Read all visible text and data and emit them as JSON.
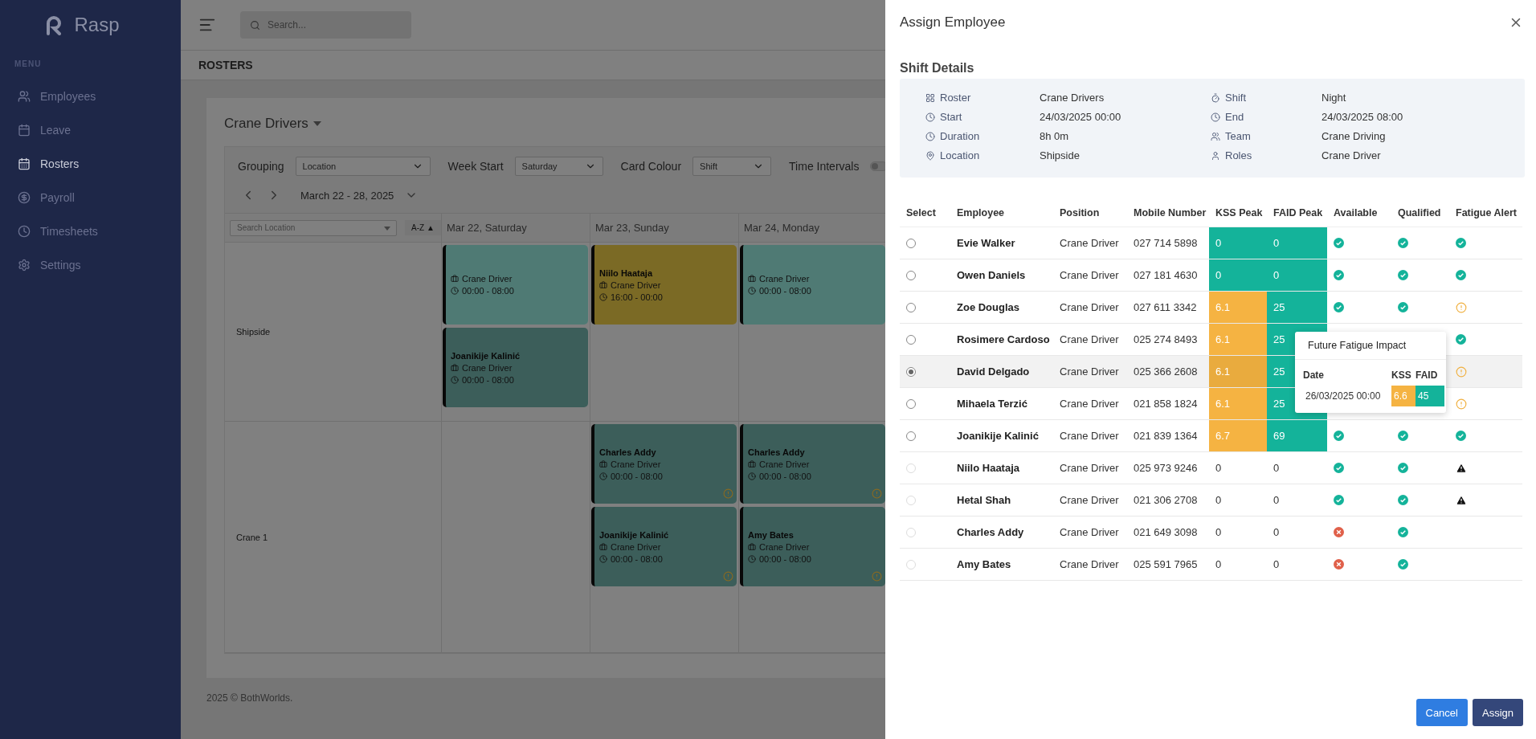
{
  "sidebar": {
    "brand": "Rasp",
    "section": "MENU",
    "items": [
      {
        "label": "Employees",
        "selected": false
      },
      {
        "label": "Leave",
        "selected": false
      },
      {
        "label": "Rosters",
        "selected": true
      },
      {
        "label": "Payroll",
        "selected": false
      },
      {
        "label": "Timesheets",
        "selected": false
      },
      {
        "label": "Settings",
        "selected": false
      }
    ]
  },
  "header": {
    "search": {
      "placeholder": "Search..."
    }
  },
  "page_title": "ROSTERS",
  "roster": {
    "name": "Crane Drivers",
    "filters": [
      {
        "label": "Grouping",
        "value": "Location"
      },
      {
        "label": "Week Start",
        "value": "Saturday"
      },
      {
        "label": "Card Colour",
        "value": "Shift"
      }
    ],
    "time_intervals": {
      "label": "Time Intervals",
      "on": false
    },
    "date_range": "March 22 - 28, 2025",
    "search_location": {
      "placeholder": "Search Location"
    },
    "sort": "A-Z ▲",
    "days": [
      "Mar 22, Saturday",
      "Mar 23, Sunday",
      "Mar 24, Monday"
    ],
    "groups": [
      {
        "name": "Shipside",
        "days": [
          {
            "kind": "shifts",
            "cards": [
              {
                "role": "Crane Driver",
                "time": "00:00 - 08:00",
                "color": "#4f7a74",
                "alert": false
              },
              {
                "employee": "Joanikije Kalinić",
                "role": "Crane Driver",
                "time": "00:00 - 08:00",
                "color": "#3c5e5a",
                "alert": false
              }
            ]
          },
          {
            "kind": "shifts",
            "cards": [
              {
                "employee": "Niilo Haataja",
                "role": "Crane Driver",
                "time": "16:00 - 00:00",
                "color": "#7b6a25",
                "alert": false
              }
            ]
          },
          {
            "kind": "shifts",
            "cards": [
              {
                "role": "Crane Driver",
                "time": "00:00 - 08:00",
                "color": "#4f7a74",
                "alert": false
              }
            ]
          }
        ]
      },
      {
        "name": "Crane 1",
        "days": [
          {
            "kind": "empty"
          },
          {
            "kind": "shifts",
            "cards": [
              {
                "employee": "Charles Addy",
                "role": "Crane Driver",
                "time": "00:00 - 08:00",
                "color": "#3c5e5a",
                "alert": true
              },
              {
                "employee": "Joanikije Kalinić",
                "role": "Crane Driver",
                "time": "00:00 - 08:00",
                "color": "#3c5e5a",
                "alert": true
              }
            ]
          },
          {
            "kind": "shifts",
            "cards": [
              {
                "employee": "Charles Addy",
                "role": "Crane Driver",
                "time": "00:00 - 08:00",
                "color": "#3c5e5a",
                "alert": true
              },
              {
                "employee": "Amy Bates",
                "role": "Crane Driver",
                "time": "00:00 - 08:00",
                "color": "#3c5e5a",
                "alert": true
              }
            ]
          }
        ]
      }
    ]
  },
  "footer": "2025 © BothWorlds.",
  "drawer": {
    "title": "Assign Employee",
    "section": "Shift Details",
    "details": [
      {
        "label": "Roster",
        "value": "Crane Drivers"
      },
      {
        "label": "Shift",
        "value": "Night"
      },
      {
        "label": "Start",
        "value": "24/03/2025 00:00"
      },
      {
        "label": "End",
        "value": "24/03/2025 08:00"
      },
      {
        "label": "Duration",
        "value": "8h 0m"
      },
      {
        "label": "Team",
        "value": "Crane Driving"
      },
      {
        "label": "Location",
        "value": "Shipside"
      },
      {
        "label": "Roles",
        "value": "Crane Driver"
      }
    ],
    "columns": [
      "Select",
      "Employee",
      "Position",
      "Mobile Number",
      "KSS Peak",
      "FAID Peak",
      "Available",
      "Qualified",
      "Fatigue Alert"
    ],
    "rows": [
      {
        "selected": false,
        "disabled": false,
        "employee": "Evie Walker",
        "position": "Crane Driver",
        "mobile": "027 714 5898",
        "kss": {
          "value": "0",
          "color": "#14b39a"
        },
        "faid": {
          "value": "0",
          "color": "#14b39a"
        },
        "available": true,
        "qualified": true,
        "fatigue_alert": {
          "kind": "ok"
        }
      },
      {
        "selected": false,
        "disabled": false,
        "employee": "Owen Daniels",
        "position": "Crane Driver",
        "mobile": "027 181 4630",
        "kss": {
          "value": "0",
          "color": "#14b39a"
        },
        "faid": {
          "value": "0",
          "color": "#14b39a"
        },
        "available": true,
        "qualified": true,
        "fatigue_alert": {
          "kind": "ok"
        }
      },
      {
        "selected": false,
        "disabled": false,
        "employee": "Zoe Douglas",
        "position": "Crane Driver",
        "mobile": "027 611 3342",
        "kss": {
          "value": "6.1",
          "color": "#f5b342"
        },
        "faid": {
          "value": "25",
          "color": "#14b39a"
        },
        "available": true,
        "qualified": true,
        "fatigue_alert": {
          "kind": "warning"
        }
      },
      {
        "selected": false,
        "disabled": false,
        "employee": "Rosimere Cardoso",
        "position": "Crane Driver",
        "mobile": "025 274 8493",
        "kss": {
          "value": "6.1",
          "color": "#f5b342"
        },
        "faid": {
          "value": "25",
          "color": "#14b39a"
        },
        "fatigue_alert": {
          "kind": "ok"
        }
      },
      {
        "selected": true,
        "disabled": false,
        "employee": "David Delgado",
        "position": "Crane Driver",
        "mobile": "025 366 2608",
        "kss": {
          "value": "6.1",
          "color": "#e9ab3e"
        },
        "faid": {
          "value": "25",
          "color": "#14b39a"
        },
        "fatigue_alert": {
          "kind": "warning"
        }
      },
      {
        "selected": false,
        "disabled": false,
        "employee": "Mihaela Terzić",
        "position": "Crane Driver",
        "mobile": "021 858 1824",
        "kss": {
          "value": "6.1",
          "color": "#f5b342"
        },
        "faid": {
          "value": "25",
          "color": "#14b39a"
        },
        "fatigue_alert": {
          "kind": "warning"
        }
      },
      {
        "selected": false,
        "disabled": false,
        "employee": "Joanikije Kalinić",
        "position": "Crane Driver",
        "mobile": "021 839 1364",
        "kss": {
          "value": "6.7",
          "color": "#f5b342"
        },
        "faid": {
          "value": "69",
          "color": "#14b39a"
        },
        "available": true,
        "qualified": true,
        "fatigue_alert": {
          "kind": "ok"
        }
      },
      {
        "selected": false,
        "disabled": true,
        "employee": "Niilo Haataja",
        "position": "Crane Driver",
        "mobile": "025 973 9246",
        "kss": {
          "value": "0"
        },
        "faid": {
          "value": "0"
        },
        "available": true,
        "qualified": true,
        "fatigue_alert": {
          "kind": "danger"
        }
      },
      {
        "selected": false,
        "disabled": true,
        "employee": "Hetal Shah",
        "position": "Crane Driver",
        "mobile": "021 306 2708",
        "kss": {
          "value": "0"
        },
        "faid": {
          "value": "0"
        },
        "available": true,
        "qualified": true,
        "fatigue_alert": {
          "kind": "danger"
        }
      },
      {
        "selected": false,
        "disabled": true,
        "employee": "Charles Addy",
        "position": "Crane Driver",
        "mobile": "021 649 3098",
        "kss": {
          "value": "0"
        },
        "faid": {
          "value": "0"
        },
        "available": false,
        "qualified": true
      },
      {
        "selected": false,
        "disabled": true,
        "employee": "Amy Bates",
        "position": "Crane Driver",
        "mobile": "025 591 7965",
        "kss": {
          "value": "0"
        },
        "faid": {
          "value": "0"
        },
        "available": false,
        "qualified": true
      }
    ],
    "popover": {
      "title": "Future Fatigue Impact",
      "columns": [
        "Date",
        "KSS",
        "FAID"
      ],
      "rows": [
        {
          "date": "26/03/2025 00:00",
          "kss": {
            "value": "6.6",
            "color": "#f5b342"
          },
          "faid": {
            "value": "45",
            "color": "#14b39a"
          }
        }
      ]
    },
    "buttons": [
      {
        "label": "Cancel",
        "kind": "secondary"
      },
      {
        "label": "Assign",
        "kind": "primary"
      }
    ]
  }
}
